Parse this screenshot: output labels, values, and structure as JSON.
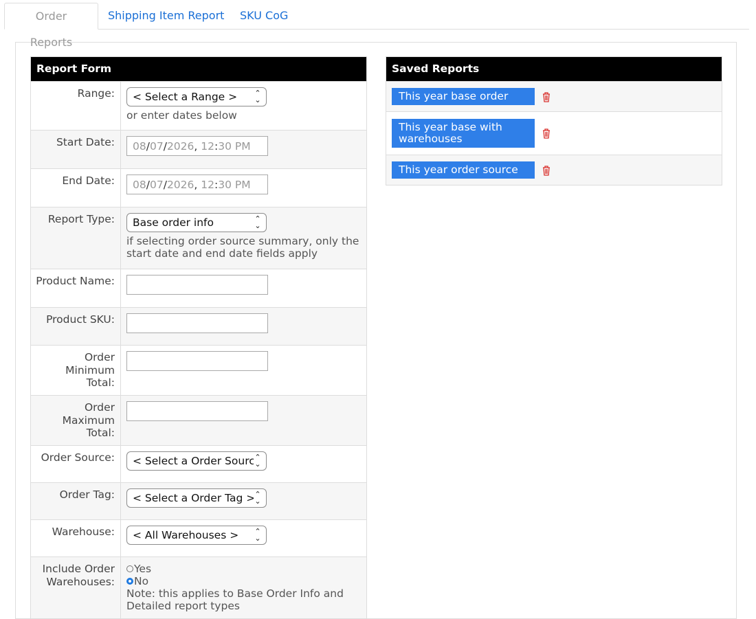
{
  "tabs": [
    {
      "label": "Order Reports",
      "active": true
    },
    {
      "label": "Shipping Item Report",
      "active": false
    },
    {
      "label": "SKU CoG",
      "active": false
    }
  ],
  "report_form": {
    "title": "Report Form",
    "range": {
      "label": "Range:",
      "value": "< Select a Range >",
      "hint": "or enter dates below"
    },
    "start_date": {
      "label": "Start Date:",
      "month": "08",
      "day": "07",
      "year": "2026",
      "hour": "12",
      "minute": "30",
      "ampm": "PM"
    },
    "end_date": {
      "label": "End Date:",
      "month": "08",
      "day": "07",
      "year": "2026",
      "hour": "12",
      "minute": "30",
      "ampm": "PM"
    },
    "report_type": {
      "label": "Report Type:",
      "value": "Base order info",
      "hint": "if selecting order source summary, only the start date and end date fields apply"
    },
    "product_name": {
      "label": "Product Name:",
      "value": ""
    },
    "product_sku": {
      "label": "Product SKU:",
      "value": ""
    },
    "order_min": {
      "label": "Order Minimum Total:",
      "value": ""
    },
    "order_max": {
      "label": "Order Maximum Total:",
      "value": ""
    },
    "order_source": {
      "label": "Order Source:",
      "value": "< Select a Order Source >"
    },
    "order_tag": {
      "label": "Order Tag:",
      "value": "< Select a Order Tag >"
    },
    "warehouse": {
      "label": "Warehouse:",
      "value": "< All Warehouses >"
    },
    "include_warehouses": {
      "label": "Include Order Warehouses:",
      "options": [
        "Yes",
        "No"
      ],
      "selected": "No",
      "note": "Note: this applies to Base Order Info and Detailed report types"
    }
  },
  "saved_reports": {
    "title": "Saved Reports",
    "items": [
      {
        "label": "This year base order"
      },
      {
        "label": "This year base with warehouses"
      },
      {
        "label": "This year order source"
      }
    ]
  },
  "colors": {
    "accent": "#2f7fe8",
    "link": "#1a6fd6",
    "header_bg": "#000000",
    "trash": "#d9302c"
  }
}
